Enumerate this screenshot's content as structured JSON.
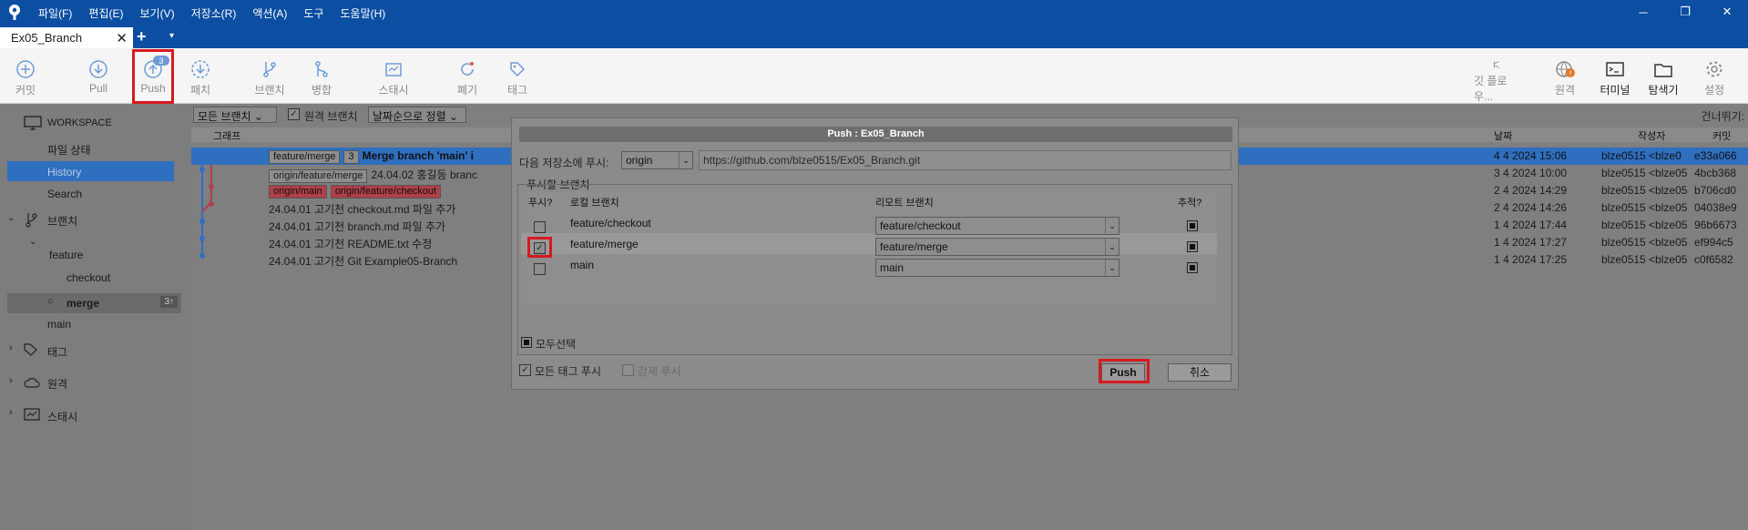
{
  "menu": [
    "파일(F)",
    "편집(E)",
    "보기(V)",
    "저장소(R)",
    "액션(A)",
    "도구",
    "도움말(H)"
  ],
  "window_controls": {
    "minimize": "─",
    "restore": "❐",
    "close": "✕"
  },
  "tab": {
    "title": "Ex05_Branch",
    "close": "✕",
    "add": "+",
    "dropdown": "▾"
  },
  "toolbar": {
    "commit": "커밋",
    "pull": "Pull",
    "push": "Push",
    "push_badge": "3",
    "fetch": "패치",
    "branch": "브랜치",
    "merge": "병합",
    "stash": "스태시",
    "discard": "폐기",
    "tag": "태그",
    "gitflow": "깃 플로우...",
    "remote": "원격",
    "terminal": "터미널",
    "explorer": "탐색기",
    "settings": "설정"
  },
  "sidebar": {
    "workspace": "WORKSPACE",
    "file_status": "파일 상태",
    "history": "History",
    "search": "Search",
    "branches": "브랜치",
    "feature": "feature",
    "checkout": "checkout",
    "merge": "merge",
    "merge_badge": "3↑",
    "main": "main",
    "tags": "태그",
    "remotes": "원격",
    "stashes": "스태시"
  },
  "filter": {
    "all_branches": "모든 브랜치",
    "remote_branches": "원격 브랜치",
    "sort": "날짜순으로 정렬",
    "jump": "건너뛰기:"
  },
  "columns": {
    "graph": "그래프",
    "date": "날짜",
    "author": "작성자",
    "commit": "커밋"
  },
  "commits": [
    {
      "tags": [
        {
          "text": "feature/merge",
          "color": "gray"
        },
        {
          "text": "3",
          "color": "gray"
        }
      ],
      "message": "Merge branch 'main' i",
      "date": "4 4 2024 15:06",
      "author": "blze0515 <blze0",
      "hash": "e33a066"
    },
    {
      "tags": [
        {
          "text": "origin/feature/merge",
          "color": "gray"
        }
      ],
      "message": "24.04.02 홍길동 branc",
      "date": "3 4 2024 10:00",
      "author": "blze0515 <blze05",
      "hash": "4bcb368"
    },
    {
      "tags": [
        {
          "text": "origin/main",
          "color": "red"
        },
        {
          "text": "origin/feature/checkout",
          "color": "red"
        }
      ],
      "message": "",
      "date": "2 4 2024 14:29",
      "author": "blze0515 <blze05",
      "hash": "b706cd0"
    },
    {
      "tags": [],
      "message": "24.04.01 고기천 checkout.md 파일 추가",
      "date": "2 4 2024 14:26",
      "author": "blze0515 <blze05",
      "hash": "04038e9"
    },
    {
      "tags": [],
      "message": "24.04.01 고기천 branch.md 파일 추가",
      "date": "1 4 2024 17:44",
      "author": "blze0515 <blze05",
      "hash": "96b6673"
    },
    {
      "tags": [],
      "message": "24.04.01 고기천 README.txt 수정",
      "date": "1 4 2024 17:27",
      "author": "blze0515 <blze05",
      "hash": "ef994c5"
    },
    {
      "tags": [],
      "message": "24.04.01 고기천 Git Example05-Branch",
      "date": "1 4 2024 17:25",
      "author": "blze0515 <blze05",
      "hash": "c0f6582"
    }
  ],
  "dialog": {
    "title": "Push : Ex05_Branch",
    "push_to_label": "다음 저장소에 푸시:",
    "remote": "origin",
    "url": "https://github.com/blze0515/Ex05_Branch.git",
    "group_label": "푸시할 브랜치",
    "col_push": "푸시?",
    "col_local": "로컬 브랜치",
    "col_remote": "리모트 브랜치",
    "col_track": "추적?",
    "rows": [
      {
        "local": "feature/checkout",
        "remote": "feature/checkout",
        "checked": false
      },
      {
        "local": "feature/merge",
        "remote": "feature/merge",
        "checked": true
      },
      {
        "local": "main",
        "remote": "main",
        "checked": false
      }
    ],
    "select_all": "모두선택",
    "push_all_tags": "모든 태그 푸시",
    "force_push": "강제 푸시",
    "push_button": "Push",
    "cancel_button": "취소"
  }
}
